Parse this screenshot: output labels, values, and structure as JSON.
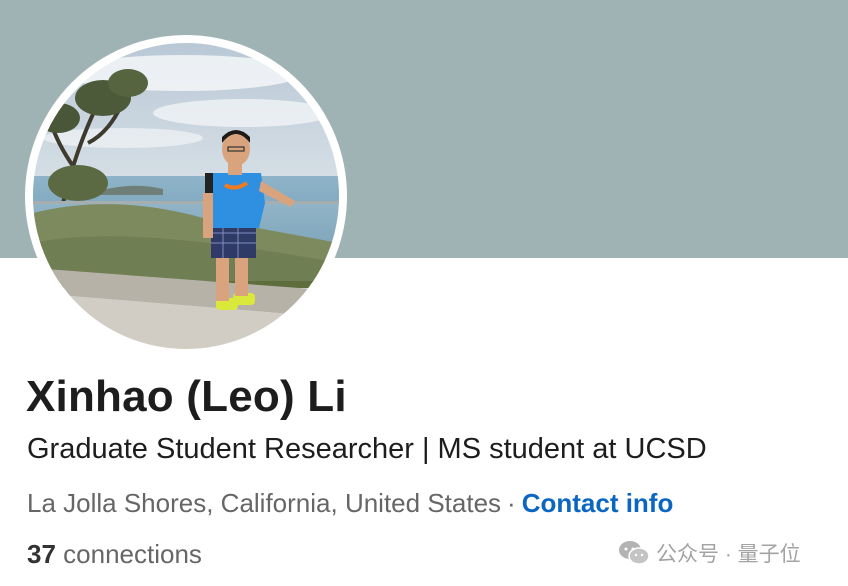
{
  "profile": {
    "name": "Xinhao (Leo) Li",
    "headline": "Graduate Student Researcher | MS student at UCSD",
    "location": "La Jolla Shores, California, United States",
    "separator": "·",
    "contact_info_label": "Contact info",
    "connections_count": "37",
    "connections_label": "connections"
  },
  "watermark": {
    "text": "公众号 · 量子位",
    "icon": "wechat-icon"
  },
  "colors": {
    "cover": "#9fb3b5",
    "link": "#0a66c2",
    "text_primary": "#1d1d1d",
    "text_secondary": "#666666"
  }
}
